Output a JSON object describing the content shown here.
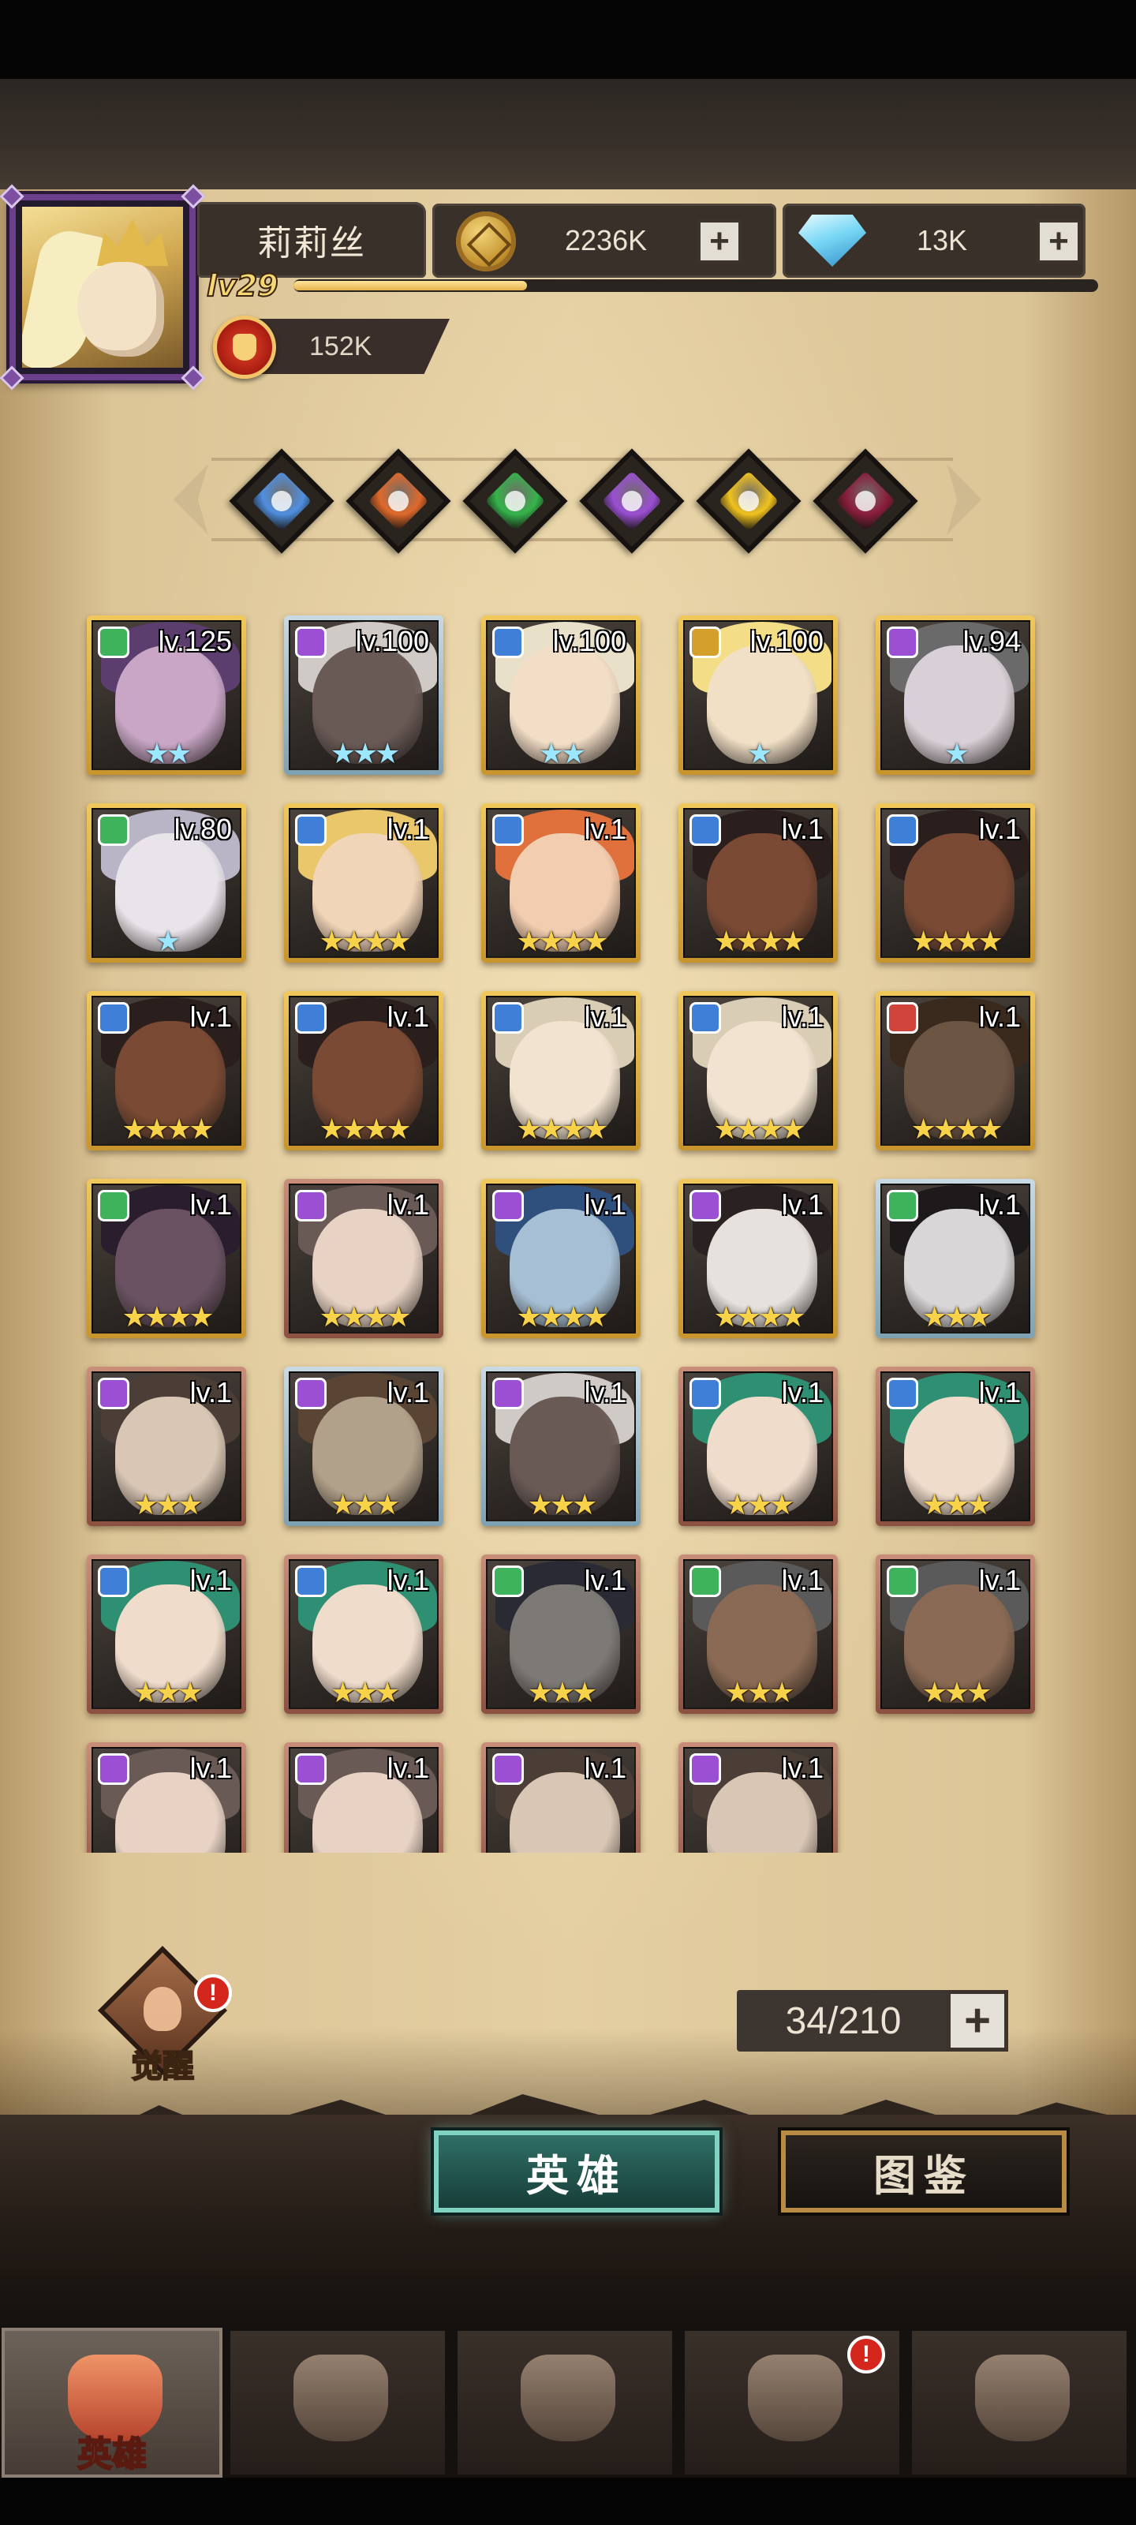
{
  "player": {
    "name": "莉莉丝",
    "level": "lv29",
    "xp_fraction": 0.29,
    "power": "152K"
  },
  "resources": {
    "gold": "2236K",
    "gems": "13K"
  },
  "factions": [
    {
      "name": "light-faction",
      "color": "#4f8fe0"
    },
    {
      "name": "fire-faction",
      "color": "#e0692b"
    },
    {
      "name": "clover-faction",
      "color": "#35b34a"
    },
    {
      "name": "arcane-faction",
      "color": "#9a4fd3"
    },
    {
      "name": "sun-faction",
      "color": "#f0c21e"
    },
    {
      "name": "blood-faction",
      "color": "#8a1e3c"
    }
  ],
  "heroes": [
    {
      "level": "lv.125",
      "stars": "★★",
      "frame": "gold",
      "class_color": "#3fb35b",
      "skin": "#c9a6c6",
      "hair": "#5b3d6e",
      "special": true
    },
    {
      "level": "lv.100",
      "stars": "★★★",
      "frame": "silver",
      "class_color": "#9b4fd3",
      "skin": "#6a5a56",
      "hair": "#cfcac6",
      "special": true
    },
    {
      "level": "lv.100",
      "stars": "★★",
      "frame": "gold",
      "class_color": "#3f7fd8",
      "skin": "#f2ddc6",
      "hair": "#e9e0c9",
      "special": true
    },
    {
      "level": "lv.100",
      "stars": "★",
      "frame": "gold",
      "class_color": "#d4a02b",
      "skin": "#f2e0c6",
      "hair": "#f3dd86",
      "special": true
    },
    {
      "level": "lv.94",
      "stars": "★",
      "frame": "gold",
      "class_color": "#9b4fd3",
      "skin": "#d9cfd6",
      "hair": "#6a6a6a",
      "special": true
    },
    {
      "level": "lv.80",
      "stars": "★",
      "frame": "gold",
      "class_color": "#3fb35b",
      "skin": "#e9e4ea",
      "hair": "#b9b4c6",
      "special": true
    },
    {
      "level": "lv.1",
      "stars": "★★★★",
      "frame": "gold",
      "class_color": "#3f7fd8",
      "skin": "#f1d5b8",
      "hair": "#e9c76a",
      "special": false
    },
    {
      "level": "lv.1",
      "stars": "★★★★",
      "frame": "gold",
      "class_color": "#3f7fd8",
      "skin": "#f2cdb0",
      "hair": "#e0713c",
      "special": false
    },
    {
      "level": "lv.1",
      "stars": "★★★★",
      "frame": "gold",
      "class_color": "#3f7fd8",
      "skin": "#7a4a34",
      "hair": "#2a1f1c",
      "special": false
    },
    {
      "level": "lv.1",
      "stars": "★★★★",
      "frame": "gold",
      "class_color": "#3f7fd8",
      "skin": "#7a4a34",
      "hair": "#2a1f1c",
      "special": false
    },
    {
      "level": "lv.1",
      "stars": "★★★★",
      "frame": "gold",
      "class_color": "#3f7fd8",
      "skin": "#7a4a34",
      "hair": "#2a1f1c",
      "special": false
    },
    {
      "level": "lv.1",
      "stars": "★★★★",
      "frame": "gold",
      "class_color": "#3f7fd8",
      "skin": "#7a4a34",
      "hair": "#2a1f1c",
      "special": false
    },
    {
      "level": "lv.1",
      "stars": "★★★★",
      "frame": "gold",
      "class_color": "#3f7fd8",
      "skin": "#f1e3cf",
      "hair": "#d9cdb5",
      "special": false
    },
    {
      "level": "lv.1",
      "stars": "★★★★",
      "frame": "gold",
      "class_color": "#3f7fd8",
      "skin": "#f1e3cf",
      "hair": "#d9cdb5",
      "special": false
    },
    {
      "level": "lv.1",
      "stars": "★★★★",
      "frame": "gold",
      "class_color": "#d0443b",
      "skin": "#6d5544",
      "hair": "#3a2a1e",
      "special": false
    },
    {
      "level": "lv.1",
      "stars": "★★★★",
      "frame": "gold",
      "class_color": "#3fb35b",
      "skin": "#6a5262",
      "hair": "#2a1e2e",
      "special": false
    },
    {
      "level": "lv.1",
      "stars": "★★★★",
      "frame": "bronze",
      "class_color": "#9b4fd3",
      "skin": "#e7d2c4",
      "hair": "#6a5a56",
      "special": false
    },
    {
      "level": "lv.1",
      "stars": "★★★★",
      "frame": "gold",
      "class_color": "#9b4fd3",
      "skin": "#a6bfd4",
      "hair": "#2f4f7c",
      "special": false
    },
    {
      "level": "lv.1",
      "stars": "★★★★",
      "frame": "gold",
      "class_color": "#9b4fd3",
      "skin": "#e6e1dd",
      "hair": "#2a2222",
      "special": false
    },
    {
      "level": "lv.1",
      "stars": "★★★",
      "frame": "silver",
      "class_color": "#3fb35b",
      "skin": "#d9d6d8",
      "hair": "#1e1a1c",
      "special": false
    },
    {
      "level": "lv.1",
      "stars": "★★★",
      "frame": "bronze",
      "class_color": "#9b4fd3",
      "skin": "#d9c6b4",
      "hair": "#4a3e36",
      "special": false
    },
    {
      "level": "lv.1",
      "stars": "★★★",
      "frame": "silver",
      "class_color": "#9b4fd3",
      "skin": "#b2a18a",
      "hair": "#5a4434",
      "special": false
    },
    {
      "level": "lv.1",
      "stars": "★★★",
      "frame": "silver",
      "class_color": "#9b4fd3",
      "skin": "#6a5a56",
      "hair": "#cfcac6",
      "special": false
    },
    {
      "level": "lv.1",
      "stars": "★★★",
      "frame": "bronze",
      "class_color": "#3f7fd8",
      "skin": "#f0dccb",
      "hair": "#2f8f72",
      "special": false
    },
    {
      "level": "lv.1",
      "stars": "★★★",
      "frame": "bronze",
      "class_color": "#3f7fd8",
      "skin": "#f0dccb",
      "hair": "#2f8f72",
      "special": false
    },
    {
      "level": "lv.1",
      "stars": "★★★",
      "frame": "bronze",
      "class_color": "#3f7fd8",
      "skin": "#f0dccb",
      "hair": "#2f8f72",
      "special": false
    },
    {
      "level": "lv.1",
      "stars": "★★★",
      "frame": "bronze",
      "class_color": "#3f7fd8",
      "skin": "#f0dccb",
      "hair": "#2f8f72",
      "special": false
    },
    {
      "level": "lv.1",
      "stars": "★★★",
      "frame": "bronze",
      "class_color": "#3fb35b",
      "skin": "#7d7a76",
      "hair": "#2a2a34",
      "special": false
    },
    {
      "level": "lv.1",
      "stars": "★★★",
      "frame": "bronze",
      "class_color": "#3fb35b",
      "skin": "#8a6a54",
      "hair": "#5a5a5a",
      "special": false
    },
    {
      "level": "lv.1",
      "stars": "★★★",
      "frame": "bronze",
      "class_color": "#3fb35b",
      "skin": "#8a6a54",
      "hair": "#5a5a5a",
      "special": false
    },
    {
      "level": "lv.1",
      "stars": "",
      "frame": "bronze",
      "class_color": "#9b4fd3",
      "skin": "#e7d2c4",
      "hair": "#6a5a56",
      "special": false
    },
    {
      "level": "lv.1",
      "stars": "",
      "frame": "bronze",
      "class_color": "#9b4fd3",
      "skin": "#e7d2c4",
      "hair": "#6a5a56",
      "special": false
    },
    {
      "level": "lv.1",
      "stars": "",
      "frame": "bronze",
      "class_color": "#9b4fd3",
      "skin": "#d9c6b4",
      "hair": "#4a3e36",
      "special": false
    },
    {
      "level": "lv.1",
      "stars": "",
      "frame": "bronze",
      "class_color": "#9b4fd3",
      "skin": "#d9c6b4",
      "hair": "#4a3e36",
      "special": false
    }
  ],
  "awaken": {
    "label": "觉醒",
    "alert": "!"
  },
  "hero_count": "34/210",
  "tabs": {
    "heroes": "英雄",
    "atlas": "图鉴"
  },
  "nav": [
    {
      "icon": "knight-helmet-icon",
      "label": "英雄",
      "active": true
    },
    {
      "icon": "war-flag-icon",
      "label": "",
      "active": false
    },
    {
      "icon": "crossed-swords-icon",
      "label": "",
      "active": false
    },
    {
      "icon": "castle-tower-icon",
      "label": "",
      "active": false,
      "alert": "!"
    },
    {
      "icon": "guild-handshake-icon",
      "label": "",
      "active": false
    }
  ]
}
